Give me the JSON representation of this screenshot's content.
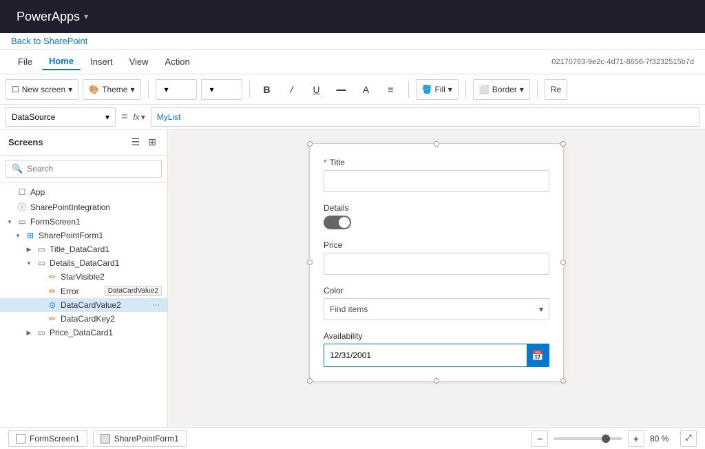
{
  "topbar": {
    "app_title": "PowerApps",
    "chevron": "▾"
  },
  "back_link": "Back to SharePoint",
  "menubar": {
    "items": [
      {
        "label": "File",
        "active": false
      },
      {
        "label": "Home",
        "active": true
      },
      {
        "label": "Insert",
        "active": false
      },
      {
        "label": "View",
        "active": false
      },
      {
        "label": "Action",
        "active": false
      }
    ],
    "guid": "02170763-9e2c-4d71-8656-7f3232515b7d"
  },
  "toolbar": {
    "new_screen_label": "New screen",
    "theme_label": "Theme",
    "fill_label": "Fill",
    "border_label": "Border"
  },
  "formulabar": {
    "property": "DataSource",
    "formula": "MyList"
  },
  "sidebar": {
    "title": "Screens",
    "search_placeholder": "Search",
    "items": [
      {
        "id": "app",
        "label": "App",
        "indent": 0,
        "icon": "app",
        "chevron": ""
      },
      {
        "id": "sharepoint-integration",
        "label": "SharePointIntegration",
        "indent": 0,
        "icon": "circle-info",
        "chevron": ""
      },
      {
        "id": "formscreen1",
        "label": "FormScreen1",
        "indent": 0,
        "icon": "screen",
        "chevron": "▾"
      },
      {
        "id": "sharepointform1",
        "label": "SharePointForm1",
        "indent": 1,
        "icon": "form",
        "chevron": "▾"
      },
      {
        "id": "title-datacard1",
        "label": "Title_DataCard1",
        "indent": 2,
        "icon": "card",
        "chevron": "▶"
      },
      {
        "id": "details-datacard1",
        "label": "Details_DataCard1",
        "indent": 2,
        "icon": "card",
        "chevron": "▾"
      },
      {
        "id": "starvisible2",
        "label": "StarVisible2",
        "indent": 3,
        "icon": "pencil",
        "chevron": ""
      },
      {
        "id": "errormessage",
        "label": "Error",
        "indent": 3,
        "icon": "pencil",
        "chevron": ""
      },
      {
        "id": "datacardvalue2",
        "label": "DataCardValue2",
        "indent": 3,
        "icon": "toggle",
        "chevron": "",
        "selected": true,
        "tooltip": "DataCardValue2"
      },
      {
        "id": "datacardkey2",
        "label": "DataCardKey2",
        "indent": 3,
        "icon": "pencil",
        "chevron": ""
      },
      {
        "id": "price-datacard1",
        "label": "Price_DataCard1",
        "indent": 2,
        "icon": "card",
        "chevron": "▶"
      }
    ]
  },
  "form": {
    "title_label": "Title",
    "title_required": "*",
    "details_label": "Details",
    "price_label": "Price",
    "color_label": "Color",
    "color_placeholder": "Find items",
    "availability_label": "Availability",
    "availability_value": "12/31/2001"
  },
  "statusbar": {
    "screen_tab": "FormScreen1",
    "form_tab": "SharePointForm1",
    "zoom_level": "80 %"
  }
}
